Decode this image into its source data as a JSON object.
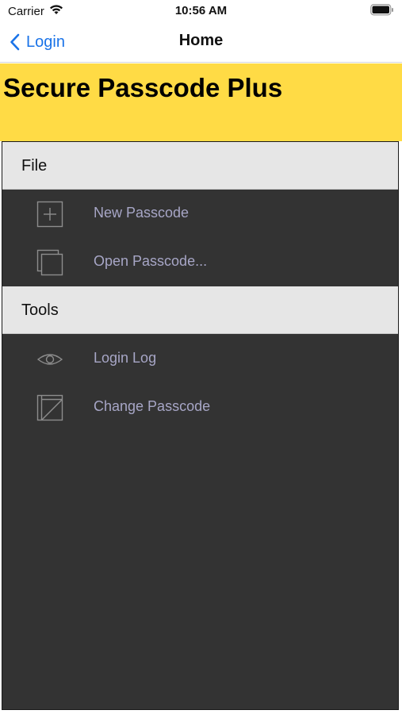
{
  "status_bar": {
    "carrier": "Carrier",
    "time": "10:56 AM"
  },
  "nav": {
    "back_label": "Login",
    "title": "Home",
    "accent_color": "#1a73e8"
  },
  "banner": {
    "title": "Secure Passcode Plus",
    "background_color": "#ffdb45"
  },
  "menu": {
    "sections": [
      {
        "label": "File",
        "items": [
          {
            "label": "New Passcode",
            "icon": "plus-square-icon"
          },
          {
            "label": "Open Passcode...",
            "icon": "stacked-squares-icon"
          }
        ]
      },
      {
        "label": "Tools",
        "items": [
          {
            "label": "Login Log",
            "icon": "eye-icon"
          },
          {
            "label": "Change Passcode",
            "icon": "edit-square-icon"
          }
        ]
      }
    ]
  }
}
